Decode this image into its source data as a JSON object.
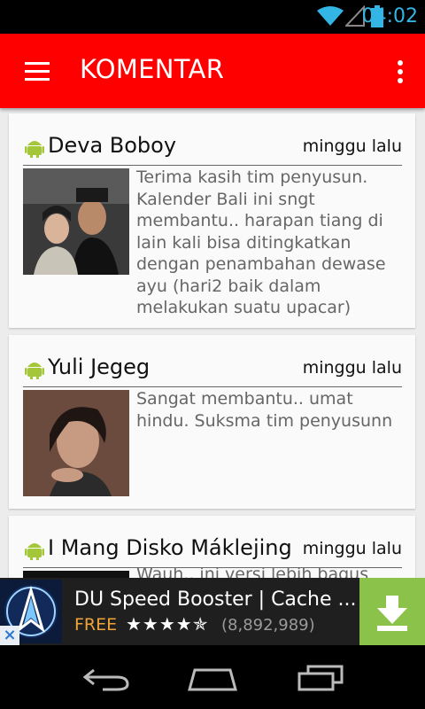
{
  "status_bar": {
    "time": "04:02"
  },
  "app_bar": {
    "title": "KOMENTAR"
  },
  "comments": [
    {
      "name": "Deva Boboy",
      "time": "minggu lalu",
      "text": "Terima kasih tim penyusun. Kalender Bali ini sngt membantu.. harapan tiang di lain kali bisa ditingkatkan dengan penambahan dewase ayu (hari2 baik dalam melakukan suatu upacar)"
    },
    {
      "name": "Yuli Jegeg",
      "time": "minggu lalu",
      "text": "Sangat membantu.. umat hindu. Suksma tim penyusunn"
    },
    {
      "name": "I Mang Disko Máklejing",
      "time": "minggu lalu",
      "text": "Wauh.. ini versi lebih bagus"
    }
  ],
  "ad": {
    "title": "DU Speed Booster | Cache ...",
    "price": "FREE",
    "stars": "★★★★✯",
    "rating_count": "(8,892,989)",
    "close": "×"
  },
  "colors": {
    "app_bar": "#fe0000",
    "status_accent": "#33b5e5",
    "android_green": "#a4c639",
    "ad_download": "#8bc34a"
  }
}
